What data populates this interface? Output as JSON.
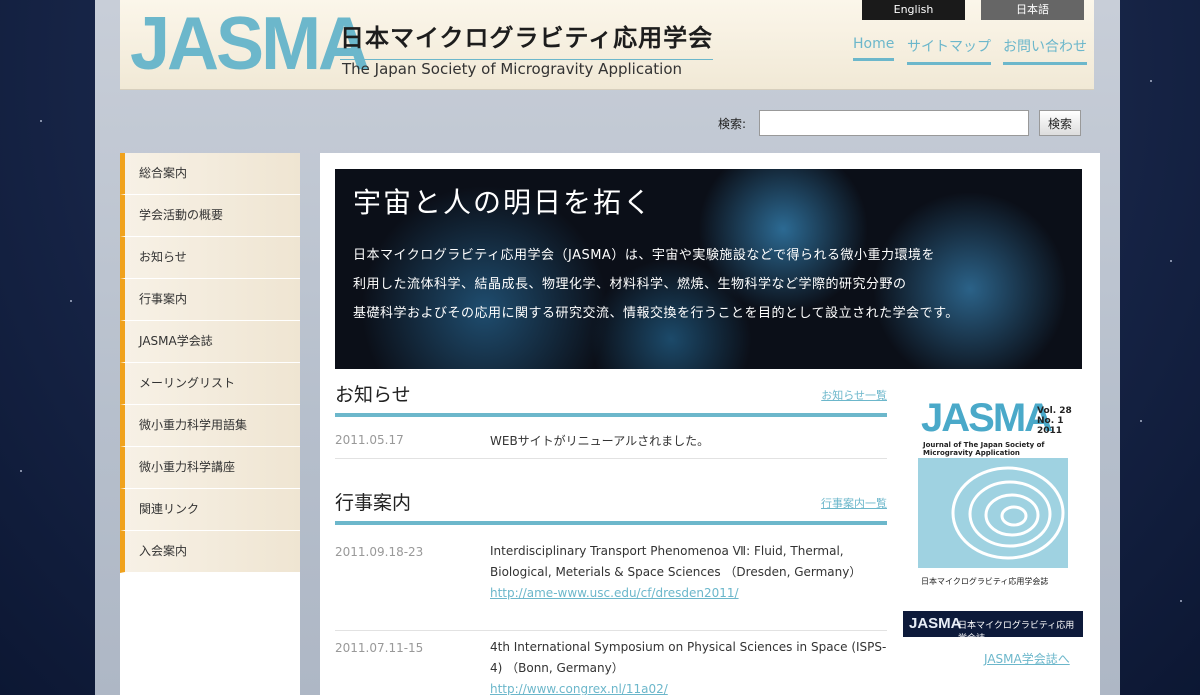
{
  "header": {
    "logo_text": "JASMA",
    "title_ja": "日本マイクログラビティ応用学会",
    "title_en": "The Japan Society of Microgravity Application",
    "lang_en": "English",
    "lang_ja": "日本語",
    "nav": [
      "Home",
      "サイトマップ",
      "お問い合わせ"
    ]
  },
  "search": {
    "label": "検索:",
    "button": "検索",
    "value": ""
  },
  "sidebar": {
    "items": [
      {
        "label": "総合案内"
      },
      {
        "label": "学会活動の概要"
      },
      {
        "label": "お知らせ"
      },
      {
        "label": "行事案内"
      },
      {
        "label": "JASMA学会誌"
      },
      {
        "label": "メーリングリスト"
      },
      {
        "label": "微小重力科学用語集"
      },
      {
        "label": "微小重力科学講座"
      },
      {
        "label": "関連リンク"
      },
      {
        "label": "入会案内"
      }
    ]
  },
  "hero": {
    "title": "宇宙と人の明日を拓く",
    "lines": [
      "日本マイクログラビティ応用学会（JASMA）は、宇宙や実験施設などで得られる微小重力環境を",
      "利用した流体科学、結晶成長、物理化学、材料科学、燃焼、生物科学など学際的研究分野の",
      "基礎科学およびその応用に関する研究交流、情報交換を行うことを目的として設立された学会です。"
    ]
  },
  "news": {
    "title": "お知らせ",
    "link": "お知らせ一覧",
    "items": [
      {
        "date": "2011.05.17",
        "text": "WEBサイトがリニューアルされました。"
      }
    ]
  },
  "events": {
    "title": "行事案内",
    "link": "行事案内一覧",
    "items": [
      {
        "date": "2011.09.18-23",
        "text": "Interdisciplinary Transport Phenomenoa Ⅶ: Fluid, Thermal, Biological, Meterials & Space Sciences （Dresden, Germany）",
        "url": "http://ame-www.usc.edu/cf/dresden2011/"
      },
      {
        "date": "2011.07.11-15",
        "text": "4th International Symposium on Physical Sciences in Space (ISPS-4) （Bonn, Germany）",
        "url": "http://www.congrex.nl/11a02/"
      }
    ]
  },
  "journal": {
    "logo": "JASMA",
    "vol": "Vol. 28",
    "no": "No. 1",
    "year": "2011",
    "subtitle": "Journal of The Japan Society of Microgravity Application",
    "footer": "日本マイクログラビティ応用学会誌",
    "banner_logo": "JASMA",
    "banner_text": "日本マイクログラビティ応用学会誌",
    "link": "JASMA学会誌へ"
  }
}
